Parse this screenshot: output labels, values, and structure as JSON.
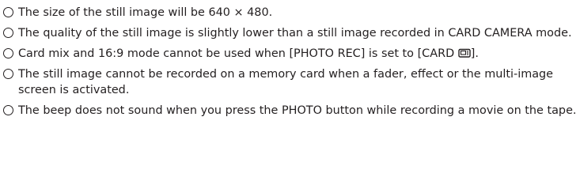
{
  "notes": [
    {
      "text": "The size of the still image will be 640 × 480."
    },
    {
      "text": "The quality of the still image is slightly lower than a still image recorded in CARD CAMERA mode."
    },
    {
      "text_before_icon": "Card mix and 16:9 mode cannot be used when [PHOTO REC] is set to [CARD ",
      "icon": "card-mode-icon",
      "text_after_icon": "]."
    },
    {
      "text": "The still image cannot be recorded on a memory card when a fader, effect or the multi-image screen is activated."
    },
    {
      "text": "The beep does not sound when you press the PHOTO button while recording a movie on the tape."
    }
  ]
}
